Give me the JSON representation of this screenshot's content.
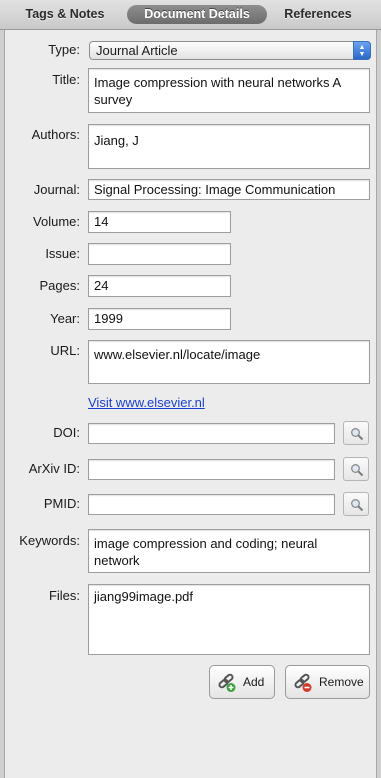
{
  "tabs": [
    {
      "label": "Tags & Notes"
    },
    {
      "label": "Document Details"
    },
    {
      "label": "References"
    }
  ],
  "form": {
    "type_label": "Type:",
    "type_value": "Journal Article",
    "title_label": "Title:",
    "title_value": "Image compression with neural networks A survey",
    "authors_label": "Authors:",
    "authors_value": "Jiang, J",
    "journal_label": "Journal:",
    "journal_value": "Signal Processing: Image Communication",
    "volume_label": "Volume:",
    "volume_value": "14",
    "issue_label": "Issue:",
    "issue_value": "",
    "pages_label": "Pages:",
    "pages_value": "24",
    "year_label": "Year:",
    "year_value": "1999",
    "url_label": "URL:",
    "url_value": "www.elsevier.nl/locate/image",
    "url_link": "Visit www.elsevier.nl",
    "doi_label": "DOI:",
    "doi_value": "",
    "arxiv_label": "ArXiv ID:",
    "arxiv_value": "",
    "pmid_label": "PMID:",
    "pmid_value": "",
    "keywords_label": "Keywords:",
    "keywords_value": "image compression and coding; neural network",
    "files_label": "Files:",
    "files_value": "jiang99image.pdf"
  },
  "buttons": {
    "add_label": "Add",
    "remove_label": "Remove"
  },
  "icons": {
    "lookup": "magnifier-icon",
    "add": "link-add-icon",
    "remove": "link-remove-icon"
  },
  "colors": {
    "link": "#1a3fd0",
    "add_badge": "#3aa13a",
    "remove_badge": "#d23a2a",
    "select_arrow": "#2a66c8"
  }
}
